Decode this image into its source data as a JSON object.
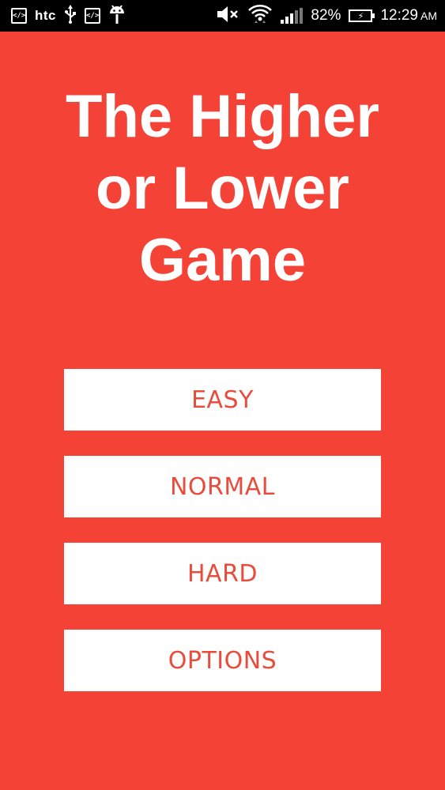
{
  "status_bar": {
    "brand": "htc",
    "dev_icon_text": "</>",
    "battery_percent": "82%",
    "time": "12:29",
    "ampm": "AM"
  },
  "title": {
    "line1": "The Higher",
    "line2": "or Lower",
    "line3": "Game"
  },
  "menu": {
    "easy": "EASY",
    "normal": "NORMAL",
    "hard": "HARD",
    "options": "OPTIONS"
  },
  "colors": {
    "background": "#f44336",
    "button_bg": "#ffffff",
    "button_text": "#e74c3c"
  },
  "icons": [
    "developer-icon",
    "usb-icon",
    "android-icon",
    "mute-icon",
    "wifi-icon",
    "signal-icon",
    "battery-charging-icon"
  ]
}
